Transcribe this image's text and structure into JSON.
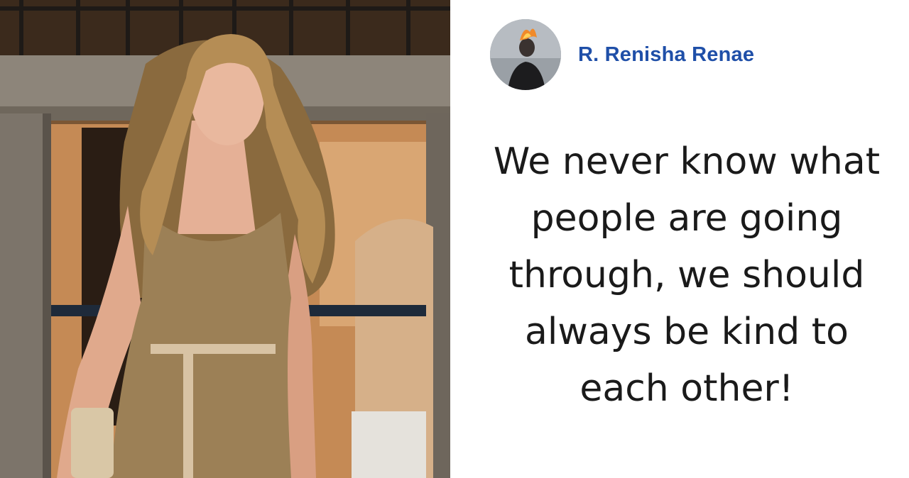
{
  "author": {
    "name": "R. Renisha Renae",
    "avatar_icon": "profile-photo-avatar"
  },
  "comment": {
    "text": "We never know what people are going through, we should always be kind to each other!"
  },
  "colors": {
    "author_name": "#1f4fa8",
    "comment_text": "#1a1a1a",
    "background": "#ffffff"
  }
}
